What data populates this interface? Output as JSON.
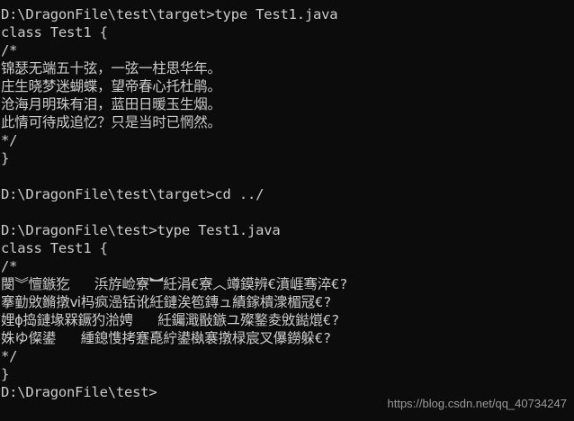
{
  "colors": {
    "background": "#0c0c0c",
    "text": "#cccccc",
    "watermark": "#9a9a9a"
  },
  "console": {
    "lines": [
      "D:\\DragonFile\\test\\target>type Test1.java",
      "class Test1 {",
      "/*",
      "锦瑟无端五十弦，一弦一柱思华年。",
      "庄生晓梦迷蝴蝶，望帝春心托杜鹃。",
      "沧海月明珠有泪，蓝田日暖玉生烟。",
      "此情可待成追忆？只是当时已惘然。",
      "*/",
      "}",
      "",
      "D:\\DragonFile\\test\\target>cd ../",
      "",
      "D:\\DragonFile\\test>type Test1.java",
      "class Test1 {",
      "/*",
      "閿︾憻鏃犵   浜斿崄寮︼紝涓€寮︿竴鏌辨€濆崕骞淬€?",
      "搴勭敓鏅撴ⅵ杩疯澏铦讹紝鏈涘笣鏄ュ績鎵樻潨楣冦€?",
      "娌ф捣鏈堟槑鐝犳湁娉   紝钃濈敯鏃ユ殩鐜夌敓鐑熴€?",
      "姝ゆ儏鍙   緟鎴愯拷蹇嗭紵鍙槸褰撴椂宸叉儤鐒躲€?",
      "*/",
      "}",
      "D:\\DragonFile\\test>"
    ]
  },
  "watermark": {
    "text": "https://blog.csdn.net/qq_40734247"
  }
}
